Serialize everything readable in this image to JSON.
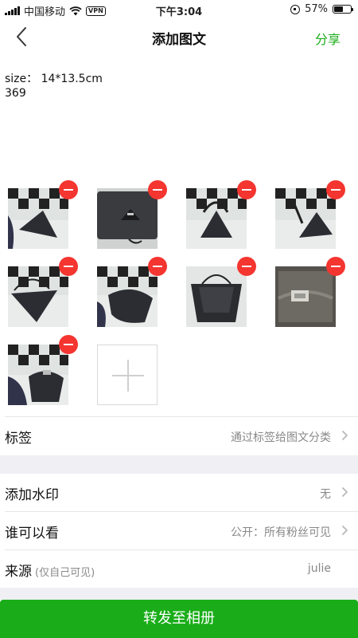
{
  "status_bar": {
    "carrier": "中国移动",
    "vpn": "VPN",
    "time": "下午3:04",
    "battery": "57%",
    "battery_level": 0.57
  },
  "nav": {
    "title": "添加图文",
    "share": "分享"
  },
  "content": {
    "text_lines": [
      "size： 14*13.5cm",
      "369"
    ]
  },
  "rows": {
    "tags": {
      "label": "标签",
      "value": "通过标签给图文分类"
    },
    "watermark": {
      "label": "添加水印",
      "value": "无"
    },
    "visibility": {
      "label": "谁可以看",
      "value": "公开：所有粉丝可见"
    },
    "source": {
      "label": "来源",
      "hint": "(仅自己可见)",
      "value": "julie"
    }
  },
  "bottom_button": "转发至相册",
  "colors": {
    "accent": "#1aad19",
    "remove": "#f43530",
    "section_gap": "#efeff4"
  }
}
